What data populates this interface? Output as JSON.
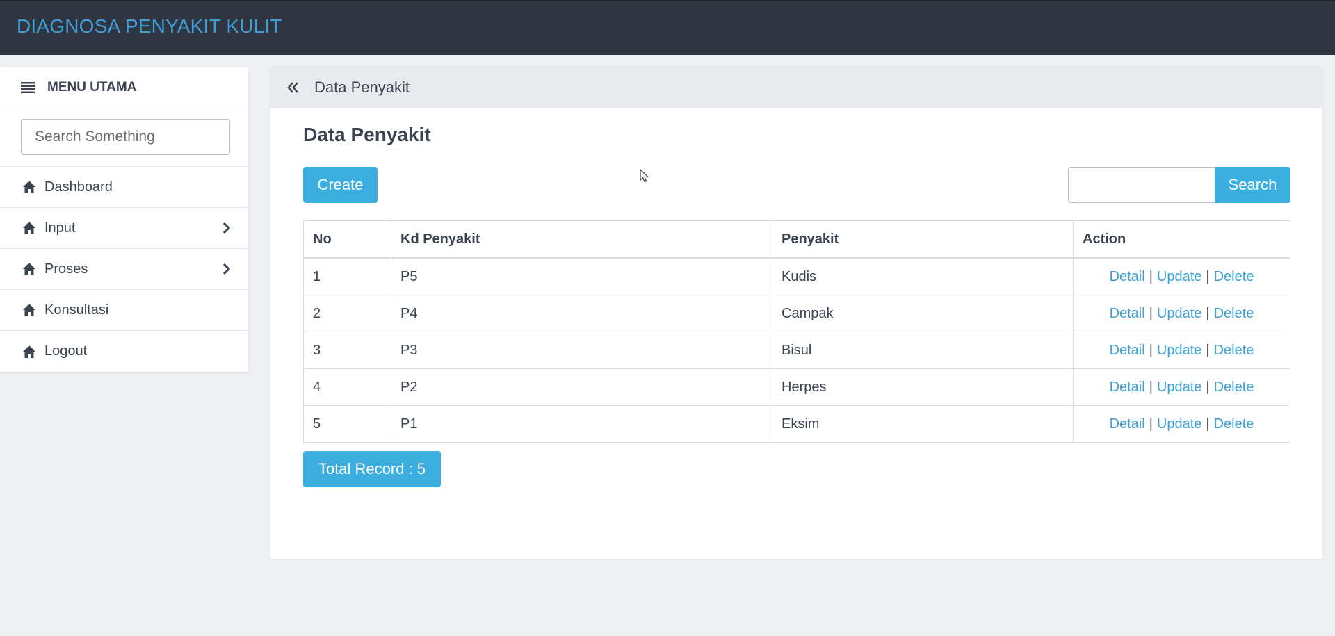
{
  "app": {
    "title": "DIAGNOSA PENYAKIT KULIT"
  },
  "sidebar": {
    "heading": "MENU UTAMA",
    "search_placeholder": "Search Something",
    "items": [
      {
        "label": "Dashboard",
        "icon": "home-icon",
        "has_submenu": false
      },
      {
        "label": "Input",
        "icon": "home-icon",
        "has_submenu": true
      },
      {
        "label": "Proses",
        "icon": "home-icon",
        "has_submenu": true
      },
      {
        "label": "Konsultasi",
        "icon": "home-icon",
        "has_submenu": false
      },
      {
        "label": "Logout",
        "icon": "home-icon",
        "has_submenu": false
      }
    ]
  },
  "breadcrumb": {
    "label": "Data Penyakit"
  },
  "main": {
    "title": "Data Penyakit",
    "create_label": "Create",
    "search_value": "",
    "search_label": "Search",
    "total_label": "Total Record : 5"
  },
  "table": {
    "headers": [
      "No",
      "Kd Penyakit",
      "Penyakit",
      "Action"
    ],
    "rows": [
      [
        "1",
        "P5",
        "Kudis"
      ],
      [
        "2",
        "P4",
        "Campak"
      ],
      [
        "3",
        "P3",
        "Bisul"
      ],
      [
        "4",
        "P2",
        "Herpes"
      ],
      [
        "5",
        "P1",
        "Eksim"
      ]
    ],
    "action_labels": {
      "detail": "Detail",
      "update": "Update",
      "delete": "Delete",
      "separator": "|"
    }
  },
  "colors": {
    "topbar": "#303641",
    "brand": "#3f9ed6",
    "accent": "#3badde",
    "link": "#3ba0d4"
  }
}
